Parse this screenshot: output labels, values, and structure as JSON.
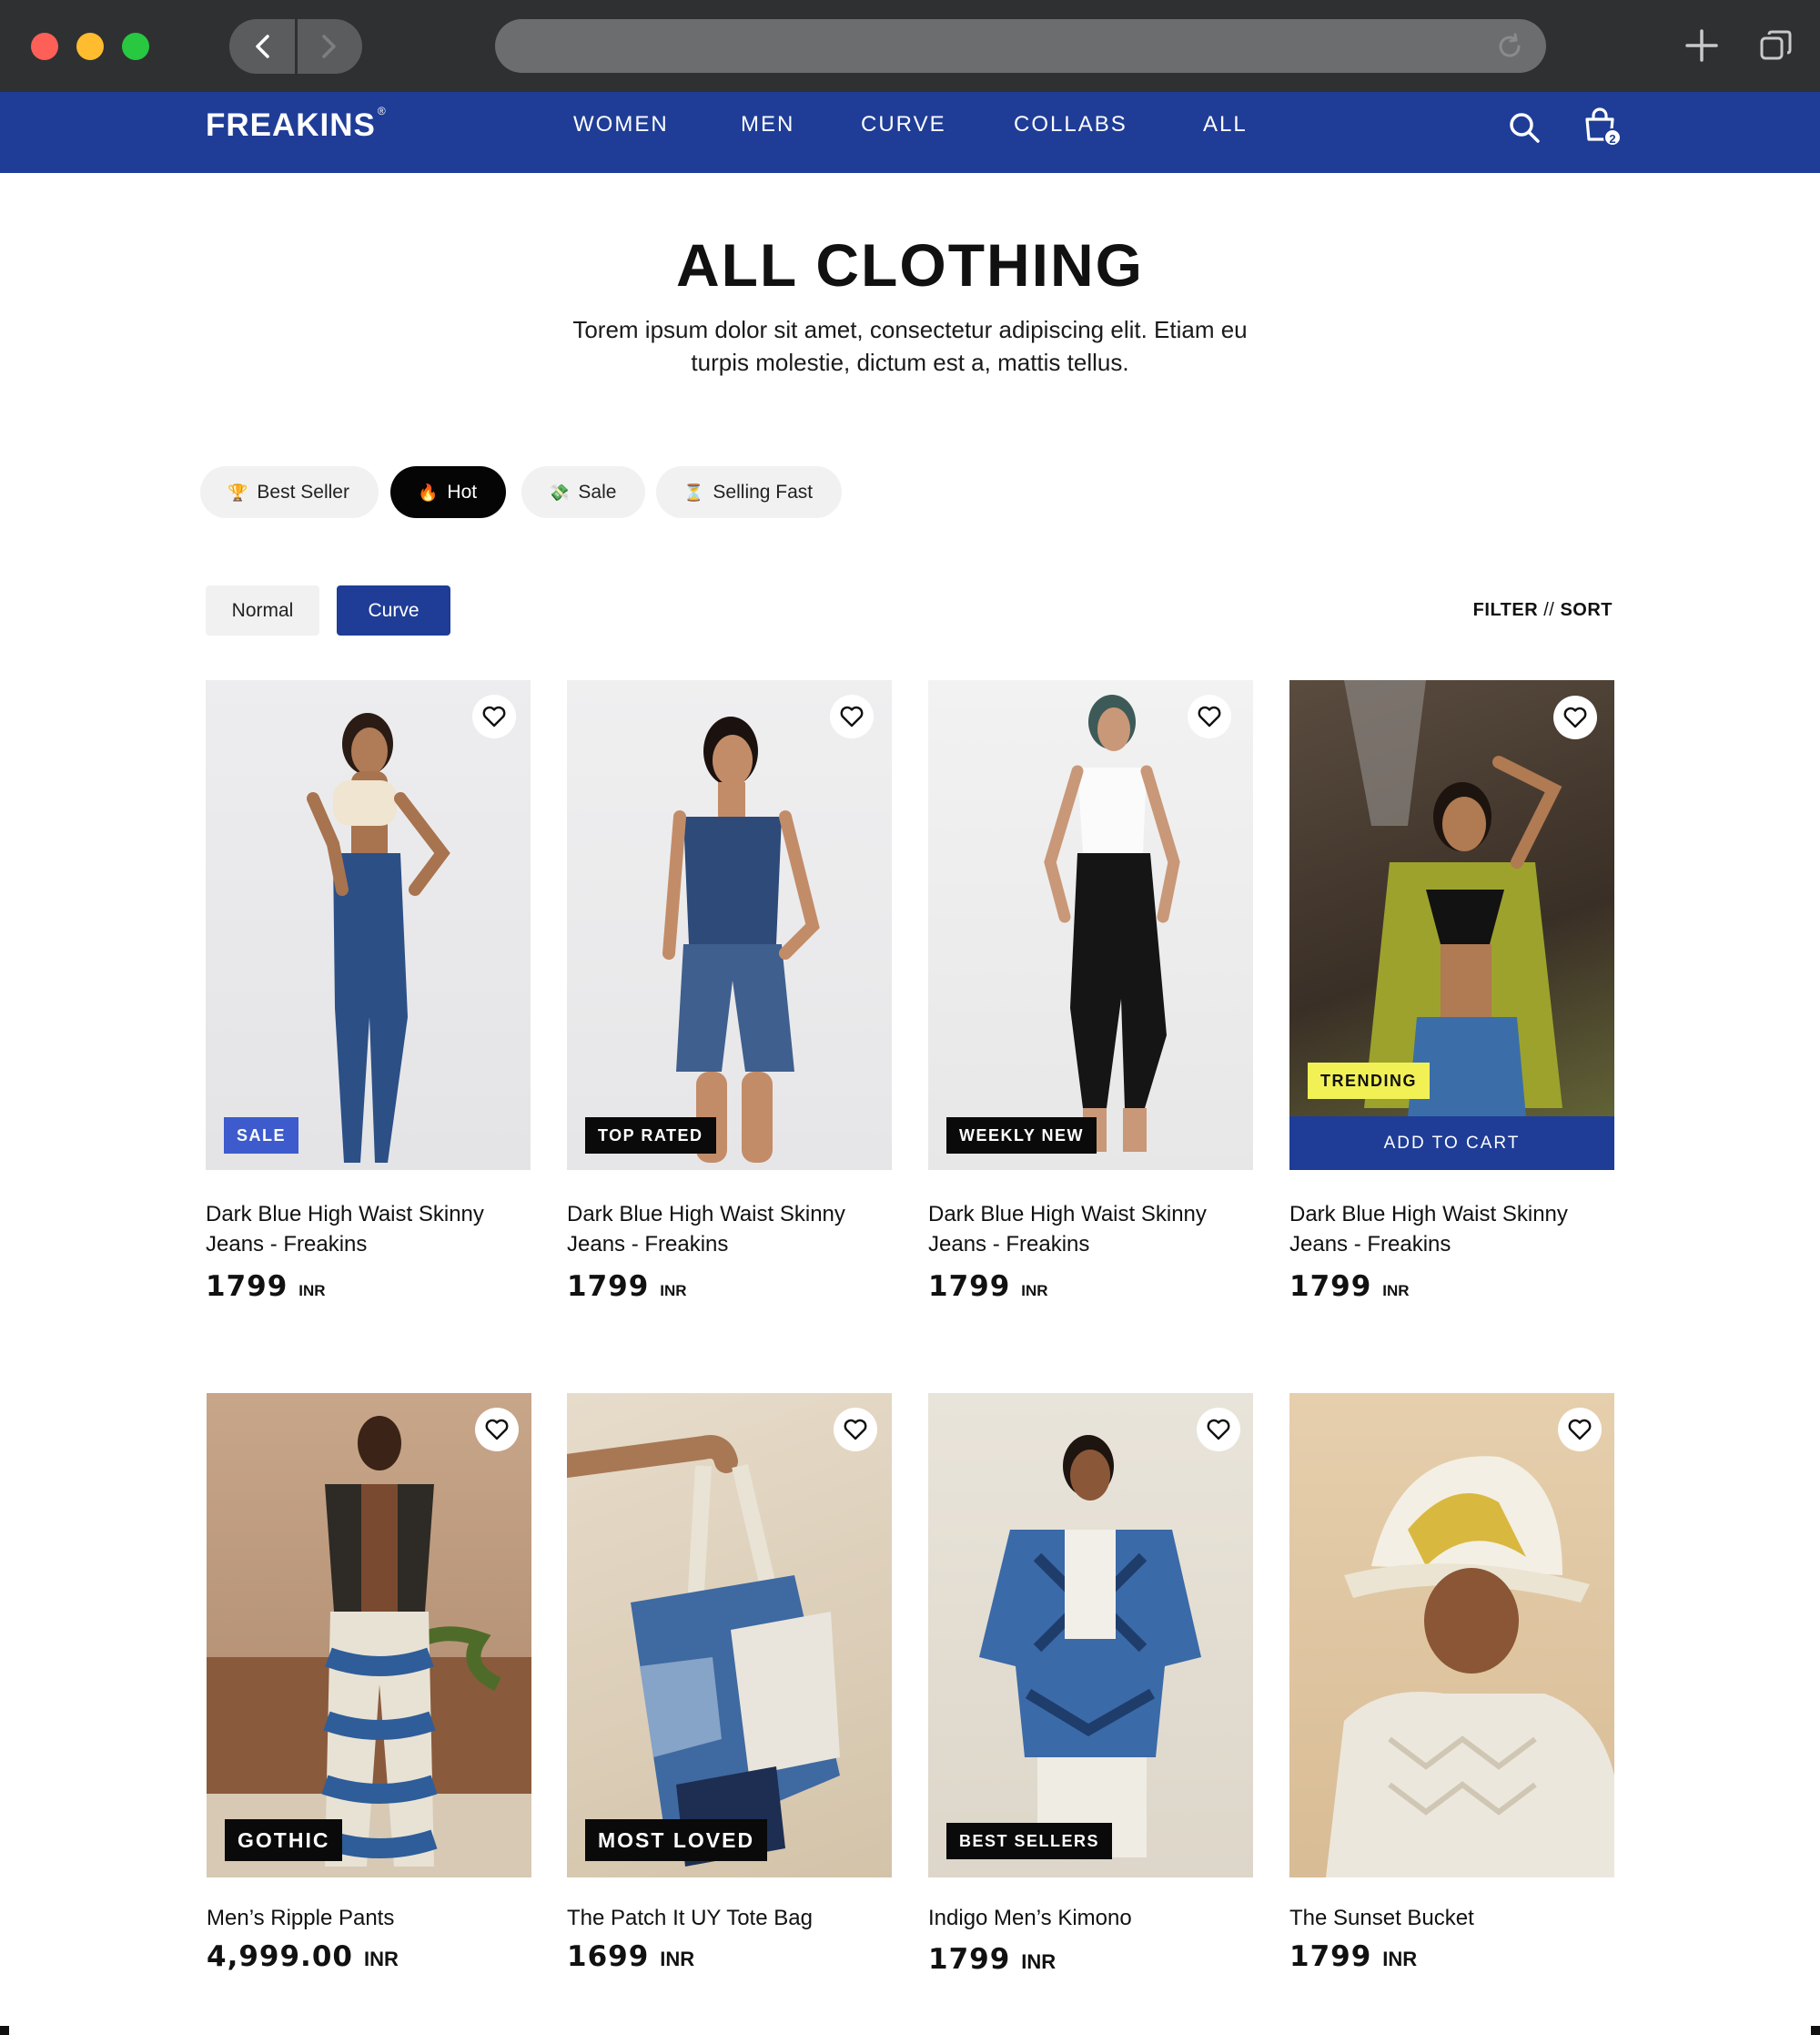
{
  "browser": {
    "url": ""
  },
  "site": {
    "logo": "FREAKINS",
    "logo_mark": "®",
    "menu": [
      "WOMEN",
      "MEN",
      "CURVE",
      "COLLABS",
      "ALL"
    ],
    "cart_count": "2",
    "brand_color": "#1f3d97"
  },
  "page": {
    "title": "ALL CLOTHING",
    "description": "Torem ipsum dolor sit amet, consectetur adipiscing elit. Etiam eu turpis molestie, dictum est a, mattis tellus."
  },
  "tags": [
    {
      "emoji": "🏆",
      "label": "Best Seller",
      "active": false
    },
    {
      "emoji": "🔥",
      "label": "Hot",
      "active": true
    },
    {
      "emoji": "💸",
      "label": "Sale",
      "active": false
    },
    {
      "emoji": "⏳",
      "label": "Selling Fast",
      "active": false
    }
  ],
  "fit_toggle": {
    "normal": "Normal",
    "curve": "Curve",
    "selected": "Curve"
  },
  "filter_sort": {
    "filter": "FILTER",
    "separator": "//",
    "sort": "SORT"
  },
  "products": [
    {
      "name": "Dark Blue High Waist Skinny Jeans - Freakins",
      "price": "1799",
      "currency": "INR",
      "badge": "SALE",
      "add_to_cart": ""
    },
    {
      "name": "Dark Blue High Waist Skinny Jeans - Freakins",
      "price": "1799",
      "currency": "INR",
      "badge": "TOP RATED",
      "add_to_cart": ""
    },
    {
      "name": "Dark Blue High Waist Skinny Jeans - Freakins",
      "price": "1799",
      "currency": "INR",
      "badge": "WEEKLY NEW",
      "add_to_cart": ""
    },
    {
      "name": "Dark Blue High Waist Skinny Jeans - Freakins",
      "price": "1799",
      "currency": "INR",
      "badge": "TRENDING",
      "add_to_cart": "ADD TO CART"
    },
    {
      "name": "Men’s Ripple Pants",
      "price": "4,999.00",
      "currency": "INR",
      "badge": "GOTHIC"
    },
    {
      "name": "The Patch It UY Tote Bag",
      "price": "1699",
      "currency": "INR",
      "badge": "MOST LOVED"
    },
    {
      "name": "Indigo Men’s Kimono",
      "price": "1799",
      "currency": "INR",
      "badge": "BEST SELLERS"
    },
    {
      "name": "The Sunset Bucket",
      "price": "1799",
      "currency": "INR",
      "badge": ""
    }
  ]
}
